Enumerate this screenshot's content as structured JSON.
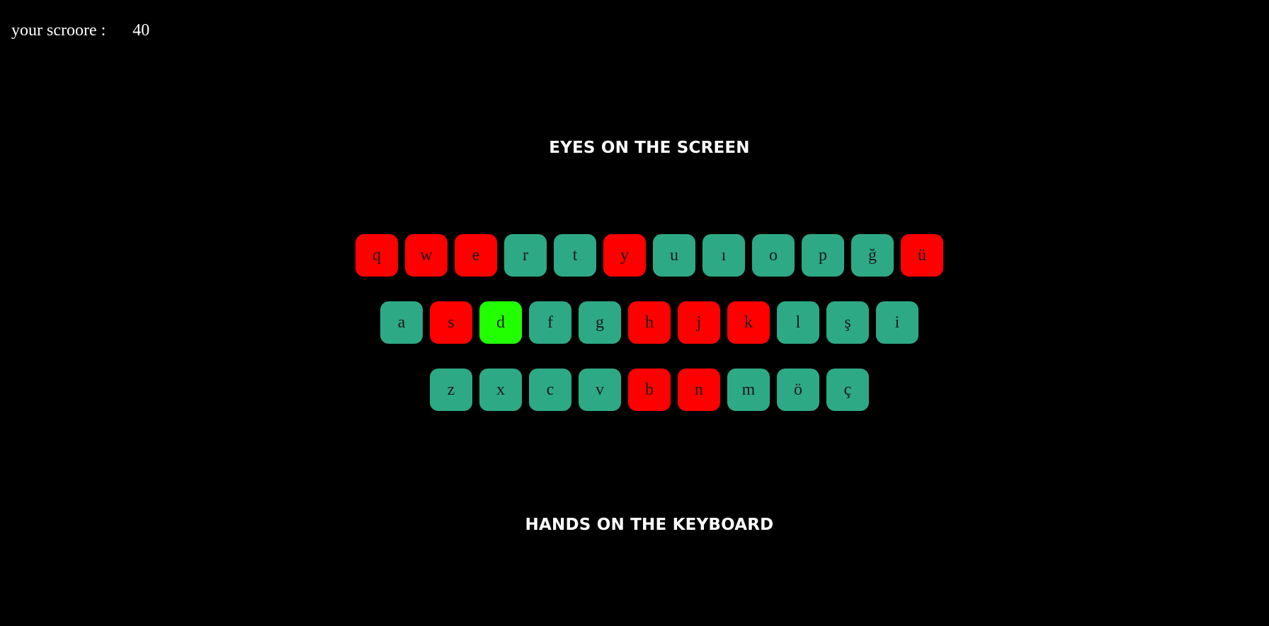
{
  "score": {
    "label": "your scroore :",
    "value": "40"
  },
  "headings": {
    "top": "EYES ON THE SCREEN",
    "bottom": "HANDS ON THE KEYBOARD"
  },
  "colors": {
    "background": "#000000",
    "key_normal": "#2ea985",
    "key_wrong": "#ff0000",
    "key_active": "#22ff00"
  },
  "keyboard": {
    "rows": [
      [
        {
          "letter": "q",
          "state": "wrong"
        },
        {
          "letter": "w",
          "state": "wrong"
        },
        {
          "letter": "e",
          "state": "wrong"
        },
        {
          "letter": "r",
          "state": "normal"
        },
        {
          "letter": "t",
          "state": "normal"
        },
        {
          "letter": "y",
          "state": "wrong"
        },
        {
          "letter": "u",
          "state": "normal"
        },
        {
          "letter": "ı",
          "state": "normal"
        },
        {
          "letter": "o",
          "state": "normal"
        },
        {
          "letter": "p",
          "state": "normal"
        },
        {
          "letter": "ğ",
          "state": "normal"
        },
        {
          "letter": "ü",
          "state": "wrong"
        }
      ],
      [
        {
          "letter": "a",
          "state": "normal"
        },
        {
          "letter": "s",
          "state": "wrong"
        },
        {
          "letter": "d",
          "state": "active"
        },
        {
          "letter": "f",
          "state": "normal"
        },
        {
          "letter": "g",
          "state": "normal"
        },
        {
          "letter": "h",
          "state": "wrong"
        },
        {
          "letter": "j",
          "state": "wrong"
        },
        {
          "letter": "k",
          "state": "wrong"
        },
        {
          "letter": "l",
          "state": "normal"
        },
        {
          "letter": "ş",
          "state": "normal"
        },
        {
          "letter": "i",
          "state": "normal"
        }
      ],
      [
        {
          "letter": "z",
          "state": "normal"
        },
        {
          "letter": "x",
          "state": "normal"
        },
        {
          "letter": "c",
          "state": "normal"
        },
        {
          "letter": "v",
          "state": "normal"
        },
        {
          "letter": "b",
          "state": "wrong"
        },
        {
          "letter": "n",
          "state": "wrong"
        },
        {
          "letter": "m",
          "state": "normal"
        },
        {
          "letter": "ö",
          "state": "normal"
        },
        {
          "letter": "ç",
          "state": "normal"
        }
      ]
    ]
  }
}
